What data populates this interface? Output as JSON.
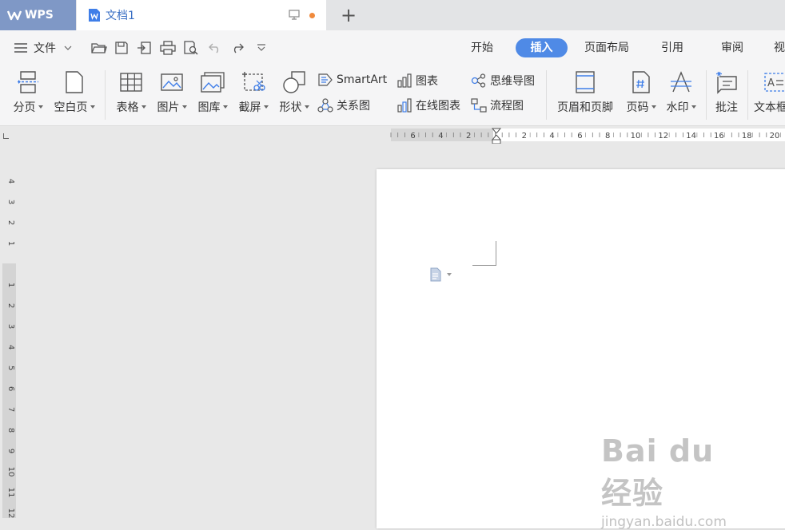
{
  "app": {
    "name": "WPS",
    "document_tab_title": "文档1"
  },
  "menu": {
    "file_label": "文件"
  },
  "ribbon_tabs": [
    {
      "label": "开始",
      "active": false
    },
    {
      "label": "插入",
      "active": true
    },
    {
      "label": "页面布局",
      "active": false
    },
    {
      "label": "引用",
      "active": false
    },
    {
      "label": "审阅",
      "active": false
    },
    {
      "label": "视",
      "active": false
    }
  ],
  "ribbon": {
    "page_break": "分页",
    "blank_page": "空白页",
    "table": "表格",
    "picture": "图片",
    "gallery": "图库",
    "screenshot": "截屏",
    "shapes": "形状",
    "smartart": "SmartArt",
    "relation_chart": "关系图",
    "chart": "图表",
    "online_chart": "在线图表",
    "mind_map": "思维导图",
    "flowchart": "流程图",
    "header_footer": "页眉和页脚",
    "page_number": "页码",
    "watermark": "水印",
    "comment": "批注",
    "textbox": "文本框"
  },
  "rulers": {
    "horizontal_labels": [
      "6",
      "4",
      "2",
      "2",
      "4",
      "6",
      "8",
      "10",
      "12",
      "14",
      "16",
      "18",
      "20"
    ],
    "vertical_labels": [
      "4",
      "3",
      "2",
      "1",
      "1",
      "2",
      "3",
      "4",
      "5",
      "6",
      "7",
      "8",
      "9",
      "10",
      "11",
      "12"
    ]
  },
  "watermark_overlay": {
    "logo": "Bai du 经验",
    "url": "jingyan.baidu.com"
  },
  "colors": {
    "accent": "#4f8ae6",
    "wps_tab": "#7f98c6",
    "unsaved_dot": "#f08a3c"
  }
}
